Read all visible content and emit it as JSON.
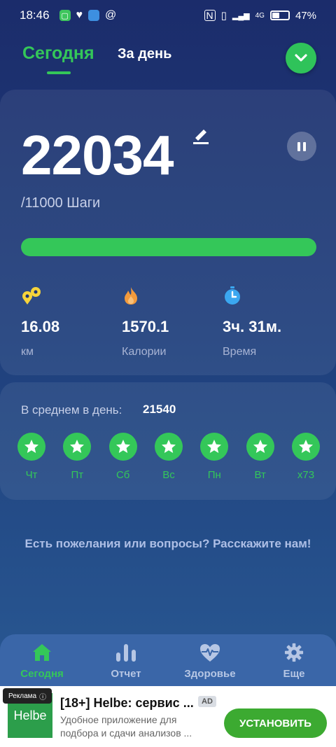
{
  "status_bar": {
    "time": "18:46",
    "network": "4G",
    "battery_percent_text": "47%",
    "battery_level": 0.47
  },
  "header": {
    "tab_today": "Сегодня",
    "tab_day": "За день"
  },
  "today": {
    "steps": "22034",
    "goal_text": "/11000 Шаги",
    "progress_fraction": 1.0,
    "stats": [
      {
        "icon": "location-pin-icon",
        "value": "16.08",
        "label": "км",
        "color": "#f6d33b"
      },
      {
        "icon": "flame-icon",
        "value": "1570.1",
        "label": "Калории",
        "color": "#f39a3c"
      },
      {
        "icon": "stopwatch-icon",
        "value": "3ч. 31м.",
        "label": "Время",
        "color": "#3ba7f0"
      }
    ]
  },
  "average": {
    "label": "В среднем в день:",
    "value": "21540",
    "days": [
      "Чт",
      "Пт",
      "Сб",
      "Вс",
      "Пн",
      "Вт",
      "x73"
    ]
  },
  "feedback_text": "Есть пожелания или вопросы? Расскажите нам!",
  "bottom_nav": [
    {
      "icon": "home-icon",
      "label": "Сегодня",
      "active": true
    },
    {
      "icon": "bar-chart-icon",
      "label": "Отчет",
      "active": false
    },
    {
      "icon": "heart-pulse-icon",
      "label": "Здоровье",
      "active": false
    },
    {
      "icon": "gear-icon",
      "label": "Еще",
      "active": false
    }
  ],
  "ad": {
    "badge": "Реклама",
    "logo_text": "Helbe",
    "title": "[18+] Helbe: сервис ...",
    "tag": "AD",
    "description": "Удобное приложение для подбора и сдачи анализов ...",
    "install_label": "УСТАНОВИТЬ"
  },
  "colors": {
    "accent": "#34c759",
    "background_top": "#1b2c6b",
    "background_bottom": "#2a5c96"
  }
}
